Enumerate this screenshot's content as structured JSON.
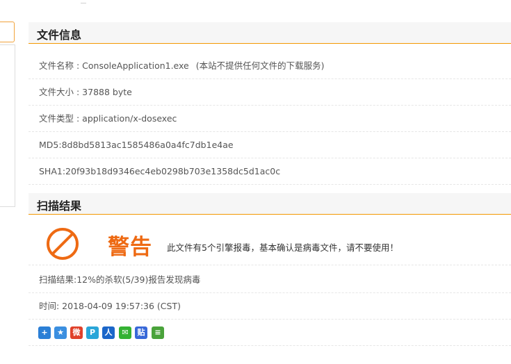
{
  "file_info": {
    "title": "文件信息",
    "name_label": "文件名称 : ",
    "name_value": "ConsoleApplication1.exe",
    "name_note": "(本站不提供任何文件的下载服务)",
    "size_label": "文件大小 : ",
    "size_value": "37888 byte",
    "type_label": "文件类型 : ",
    "type_value": "application/x-dosexec",
    "md5": "MD5:8d8bd5813ac1585486a0a4fc7db1e4ae",
    "sha1": "SHA1:20f93b18d9346ec4eb0298b703e1358dc5d1ac0c"
  },
  "scan": {
    "title": "扫描结果",
    "warning_title": "警告",
    "warning_message": "此文件有5个引擎报毒，基本确认是病毒文件，请不要使用！",
    "result": "扫描结果:12%的杀软(5/39)报告发现病毒",
    "time": "时间: 2018-04-09 19:57:36 (CST)",
    "colors": {
      "accent": "#f39800",
      "warning": "#ee6a13"
    }
  },
  "share": {
    "icons": [
      {
        "name": "share-add-icon",
        "glyph": "+",
        "color": "#2b7fd6"
      },
      {
        "name": "share-qzone-icon",
        "glyph": "★",
        "color": "#3b8fe0"
      },
      {
        "name": "share-weibo-icon",
        "glyph": "微",
        "color": "#e0402a"
      },
      {
        "name": "share-tencent-weibo-icon",
        "glyph": "P",
        "color": "#2aa6d8"
      },
      {
        "name": "share-renren-icon",
        "glyph": "人",
        "color": "#1b66c9"
      },
      {
        "name": "share-wechat-icon",
        "glyph": "✉",
        "color": "#34b233"
      },
      {
        "name": "share-tieba-icon",
        "glyph": "贴",
        "color": "#3868d8"
      },
      {
        "name": "share-tieba-icon-2",
        "glyph": "≡",
        "color": "#4aa33b"
      }
    ]
  }
}
